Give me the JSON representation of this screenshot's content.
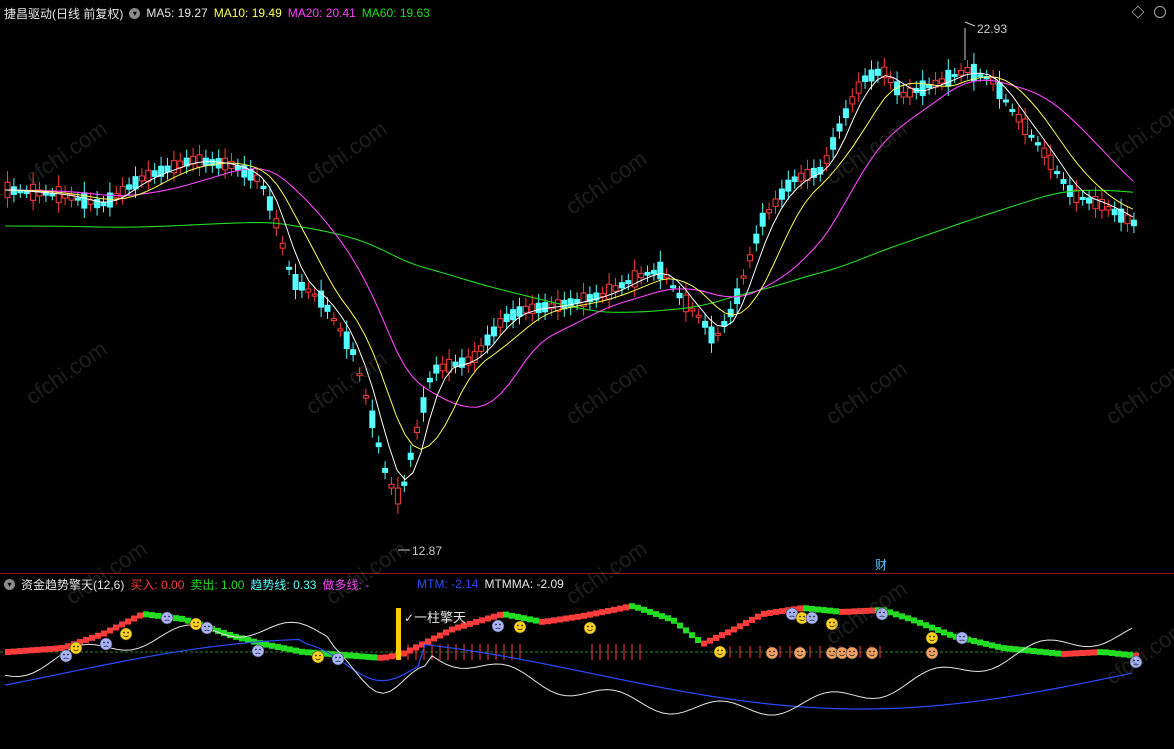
{
  "main_header": {
    "title": "捷昌驱动(日线 前复权)",
    "ma5": "MA5: 19.27",
    "ma10": "MA10: 19.49",
    "ma20": "MA20: 20.41",
    "ma60": "MA60: 19.63"
  },
  "main_annotations": {
    "high_label": "22.93",
    "low_label": "12.87",
    "finance_marker": "财"
  },
  "sub_header": {
    "title": "资金趋势擎天(12,6)",
    "buy": "买入: 0.00",
    "sell": "卖出: 1.00",
    "trend": "趋势线: 0.33",
    "long_line": "做多线: -",
    "mtm": "MTM: -2.14",
    "mtmma": "MTMMA: -2.09"
  },
  "sub_annotations": {
    "signal_label": "一柱擎天"
  },
  "watermark": "cfchi.com",
  "colors": {
    "up": "#ff3c3c",
    "down": "#54ffff",
    "ma5": "#ffffff",
    "ma10": "#ffff55",
    "ma20": "#ff44ff",
    "ma60": "#22dd22",
    "mtm": "#2a4cff",
    "accent_bar": "#ffcc00"
  },
  "chart_data": {
    "type": "candlestick",
    "title": "捷昌驱动(日线 前复权)",
    "y_high_marker": 22.93,
    "y_low_marker": 12.87,
    "series": [
      {
        "name": "MA5",
        "last": 19.27
      },
      {
        "name": "MA10",
        "last": 19.49
      },
      {
        "name": "MA20",
        "last": 20.41
      },
      {
        "name": "MA60",
        "last": 19.63
      }
    ],
    "indicator": {
      "name": "资金趋势擎天(12,6)",
      "buy": 0.0,
      "sell": 1.0,
      "trend": 0.33,
      "MTM": -2.14,
      "MTMMA": -2.09
    }
  }
}
